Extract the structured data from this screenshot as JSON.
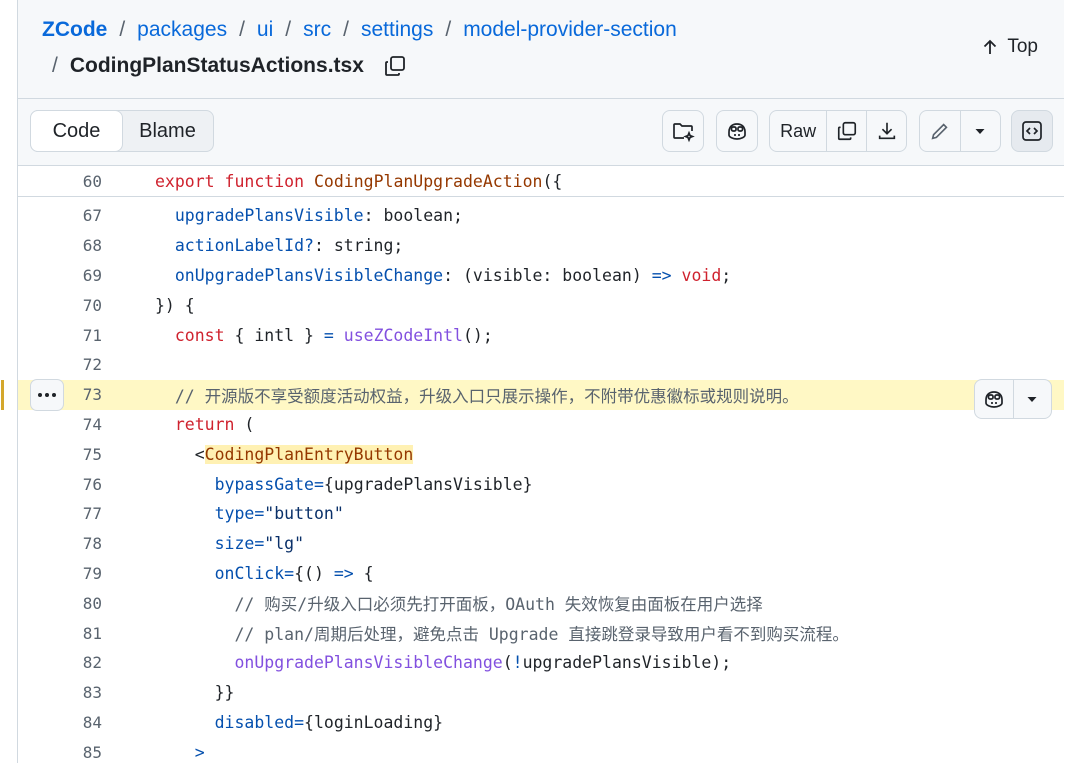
{
  "breadcrumb": {
    "items": [
      "ZCode",
      "packages",
      "ui",
      "src",
      "settings",
      "model-provider-section"
    ],
    "separator": "/",
    "filename": "CodingPlanStatusActions.tsx"
  },
  "top_link": "Top",
  "toolbar": {
    "tabs": [
      "Code",
      "Blame"
    ],
    "active_tab": "Code",
    "raw_label": "Raw"
  },
  "sticky": {
    "line": "60",
    "text_parts": [
      "export",
      "function",
      "CodingPlanUpgradeAction",
      "({"
    ]
  },
  "code": [
    {
      "n": "67",
      "parts": [
        [
          "pr",
          "  upgradePlansVisible"
        ],
        [
          "",
          "",
          ""
        ],
        [
          "",
          ": boolean;"
        ]
      ]
    },
    {
      "n": "68",
      "parts": [
        [
          "pr",
          "  actionLabelId?"
        ],
        [
          "",
          ": string;"
        ]
      ]
    },
    {
      "n": "69",
      "parts": [
        [
          "pr",
          "  onUpgradePlansVisibleChange"
        ],
        [
          "",
          ": (visible: boolean) "
        ],
        [
          "pr",
          "=>"
        ],
        [
          "",
          ""
        ],
        [
          "kw",
          " void"
        ],
        [
          "",
          ";"
        ]
      ]
    },
    {
      "n": "70",
      "parts": [
        [
          "",
          "}) {"
        ]
      ]
    },
    {
      "n": "71",
      "parts": [
        [
          "kw",
          "  const"
        ],
        [
          "",
          " { intl } "
        ],
        [
          "pr",
          "="
        ],
        [
          "fn",
          " useZCodeIntl"
        ],
        [
          "",
          "();"
        ]
      ]
    },
    {
      "n": "72",
      "parts": [
        [
          "",
          ""
        ]
      ]
    },
    {
      "n": "73",
      "parts": [
        [
          "cm",
          "  // 开源版不享受额度活动权益，升级入口只展示操作，不附带优惠徽标或规则说明。"
        ]
      ],
      "highlight": true
    },
    {
      "n": "74",
      "parts": [
        [
          "kw",
          "  return"
        ],
        [
          "",
          " ("
        ]
      ]
    },
    {
      "n": "75",
      "parts": [
        [
          "",
          "    <"
        ],
        [
          "tgh",
          "CodingPlanEntryButton"
        ]
      ]
    },
    {
      "n": "76",
      "parts": [
        [
          "pr",
          "      bypassGate"
        ],
        [
          "pr",
          "="
        ],
        [
          "",
          "{upgradePlansVisible}"
        ]
      ]
    },
    {
      "n": "77",
      "parts": [
        [
          "pr",
          "      type"
        ],
        [
          "pr",
          "="
        ],
        [
          "st",
          "\"button\""
        ]
      ]
    },
    {
      "n": "78",
      "parts": [
        [
          "pr",
          "      size"
        ],
        [
          "pr",
          "="
        ],
        [
          "st",
          "\"lg\""
        ]
      ]
    },
    {
      "n": "79",
      "parts": [
        [
          "pr",
          "      onClick"
        ],
        [
          "pr",
          "="
        ],
        [
          "",
          "{() "
        ],
        [
          "pr",
          "=>"
        ],
        [
          "",
          " {"
        ]
      ]
    },
    {
      "n": "80",
      "parts": [
        [
          "cm",
          "        // 购买/升级入口必须先打开面板，OAuth 失效恢复由面板在用户选择"
        ]
      ]
    },
    {
      "n": "81",
      "parts": [
        [
          "cm",
          "        // plan/周期后处理，避免点击 Upgrade 直接跳登录导致用户看不到购买流程。"
        ]
      ]
    },
    {
      "n": "82",
      "parts": [
        [
          "fn",
          "        onUpgradePlansVisibleChange"
        ],
        [
          "",
          "("
        ],
        [
          "pr",
          "!"
        ],
        [
          "",
          "upgradePlansVisible);"
        ]
      ]
    },
    {
      "n": "83",
      "parts": [
        [
          "",
          "      }}"
        ]
      ]
    },
    {
      "n": "84",
      "parts": [
        [
          "pr",
          "      disabled"
        ],
        [
          "pr",
          "="
        ],
        [
          "",
          "{loginLoading}"
        ]
      ]
    },
    {
      "n": "85",
      "parts": [
        [
          "pr",
          "    >"
        ]
      ]
    }
  ],
  "colors": {
    "link": "#0969da",
    "keyword": "#cf222e",
    "function": "#8250df",
    "property": "#0550ae",
    "string": "#0a3069",
    "comment": "#59636e",
    "highlight": "#fff8c5"
  }
}
